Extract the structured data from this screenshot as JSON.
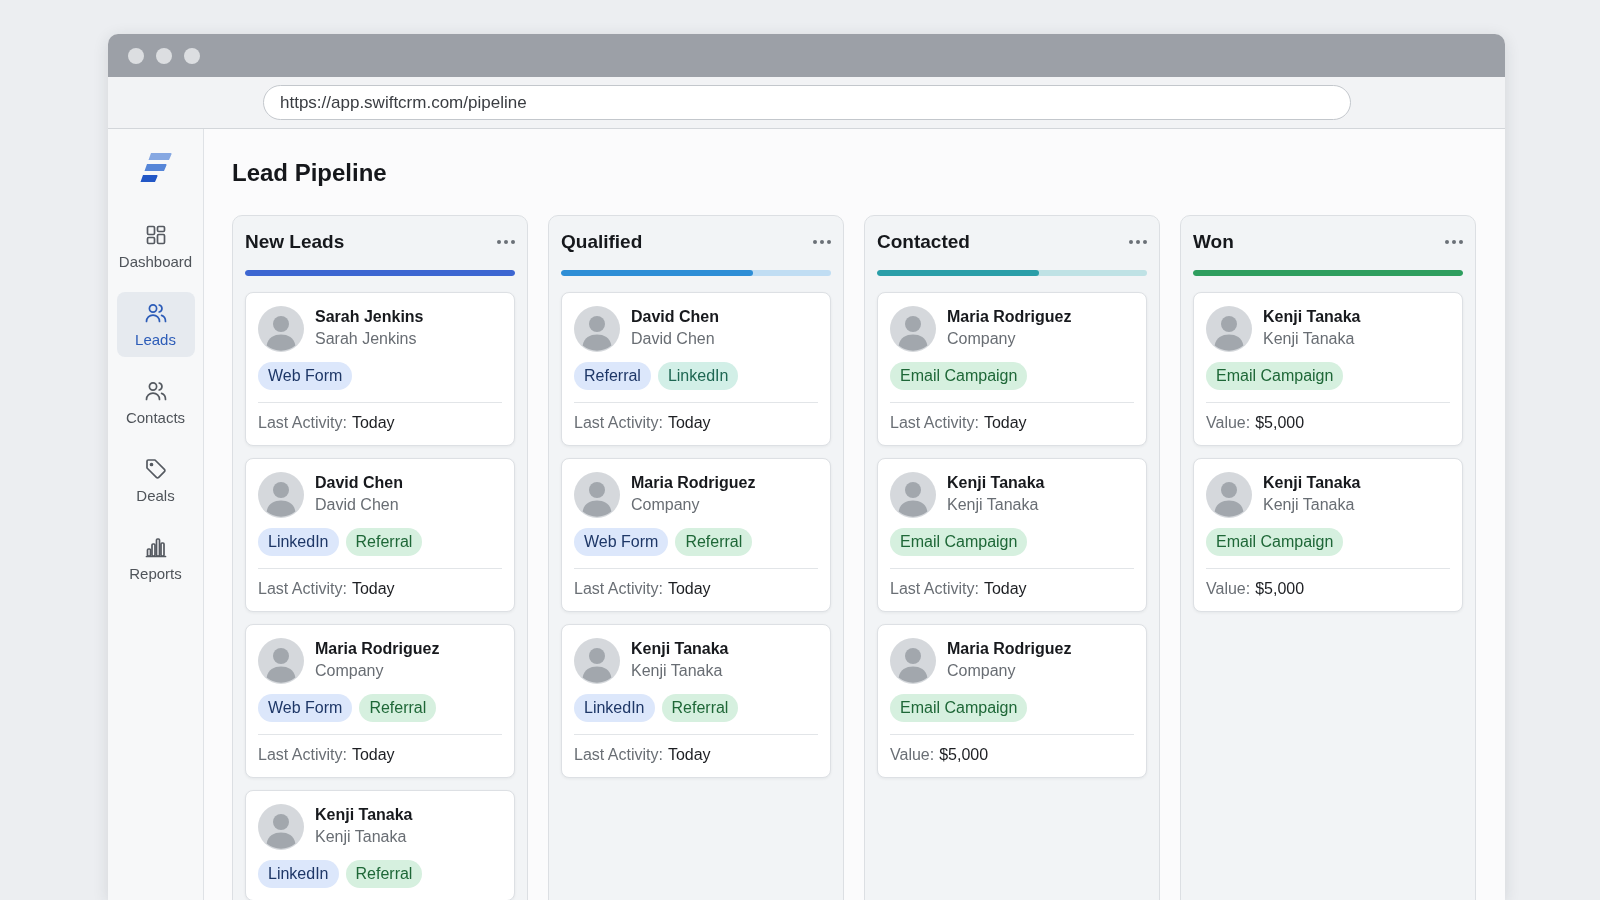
{
  "browser": {
    "url": "https://app.swiftcrm.com/pipeline"
  },
  "sidebar": {
    "items": [
      {
        "label": "Dashboard",
        "selected": false
      },
      {
        "label": "Leads",
        "selected": true
      },
      {
        "label": "Contacts",
        "selected": false
      },
      {
        "label": "Deals",
        "selected": false
      },
      {
        "label": "Reports",
        "selected": false
      }
    ]
  },
  "page": {
    "title": "Lead Pipeline"
  },
  "columns": [
    {
      "title": "New Leads",
      "level": 1,
      "color": "#3d66d1",
      "cards": [
        {
          "name": "Sarah Jenkins",
          "subtitle": "Sarah Jenkins",
          "tags": [
            {
              "label": "Web Form",
              "color": "#dce7fb"
            }
          ],
          "footer": {
            "label": "Last Activity:",
            "value": "Today"
          }
        },
        {
          "name": "David Chen",
          "subtitle": "David Chen",
          "tags": [
            {
              "label": "LinkedIn",
              "color": "#dce7fb"
            },
            {
              "label": "Referral",
              "color": "#d6f0df"
            }
          ],
          "footer": {
            "label": "Last Activity:",
            "value": "Today"
          }
        },
        {
          "name": "Maria Rodriguez",
          "subtitle": "Company",
          "tags": [
            {
              "label": "Web Form",
              "color": "#dce7fb"
            },
            {
              "label": "Referral",
              "color": "#d6f0df"
            }
          ],
          "footer": {
            "label": "Last Activity:",
            "value": "Today"
          }
        },
        {
          "name": "Kenji Tanaka",
          "subtitle": "Kenji Tanaka",
          "tags": [
            {
              "label": "LinkedIn",
              "color": "#dce7fb"
            },
            {
              "label": "Referral",
              "color": "#d6f0df"
            }
          ]
        }
      ]
    },
    {
      "title": "Qualified",
      "level": 0.71,
      "color": "#2e8ed6",
      "cards": [
        {
          "name": "David Chen",
          "subtitle": "David Chen",
          "tags": [
            {
              "label": "Referral",
              "color": "#dce7fb"
            },
            {
              "label": "LinkedIn",
              "color": "#d2efe7"
            }
          ],
          "footer": {
            "label": "Last Activity:",
            "value": "Today"
          }
        },
        {
          "name": "Maria Rodriguez",
          "subtitle": "Company",
          "tags": [
            {
              "label": "Web Form",
              "color": "#dce7fb"
            },
            {
              "label": "Referral",
              "color": "#d6f0df"
            }
          ],
          "footer": {
            "label": "Last Activity:",
            "value": "Today"
          }
        },
        {
          "name": "Kenji Tanaka",
          "subtitle": "Kenji Tanaka",
          "tags": [
            {
              "label": "LinkedIn",
              "color": "#dce7fb"
            },
            {
              "label": "Referral",
              "color": "#d6f0df"
            }
          ],
          "footer": {
            "label": "Last Activity:",
            "value": "Today"
          }
        }
      ]
    },
    {
      "title": "Contacted",
      "level": 0.6,
      "color": "#2a9ea8",
      "cards": [
        {
          "name": "Maria Rodriguez",
          "subtitle": "Company",
          "tags": [
            {
              "label": "Email Campaign",
              "color": "#d6f0df"
            }
          ],
          "footer": {
            "label": "Last Activity:",
            "value": "Today"
          }
        },
        {
          "name": "Kenji Tanaka",
          "subtitle": "Kenji Tanaka",
          "tags": [
            {
              "label": "Email Campaign",
              "color": "#d6f0df"
            }
          ],
          "footer": {
            "label": "Last Activity:",
            "value": "Today"
          }
        },
        {
          "name": "Maria Rodriguez",
          "subtitle": "Company",
          "tags": [
            {
              "label": "Email Campaign",
              "color": "#d6f0df"
            }
          ],
          "footer": {
            "label": "Value:",
            "value": "$5,000"
          }
        }
      ]
    },
    {
      "title": "Won",
      "level": 1,
      "color": "#2f9e5f",
      "cards": [
        {
          "name": "Kenji Tanaka",
          "subtitle": "Kenji Tanaka",
          "tags": [
            {
              "label": "Email Campaign",
              "color": "#d6f0df"
            }
          ],
          "footer": {
            "label": "Value:",
            "value": "$5,000"
          }
        },
        {
          "name": "Kenji Tanaka",
          "subtitle": "Kenji Tanaka",
          "tags": [
            {
              "label": "Email Campaign",
              "color": "#d6f0df"
            }
          ],
          "footer": {
            "label": "Value:",
            "value": "$5,000"
          }
        }
      ]
    }
  ]
}
